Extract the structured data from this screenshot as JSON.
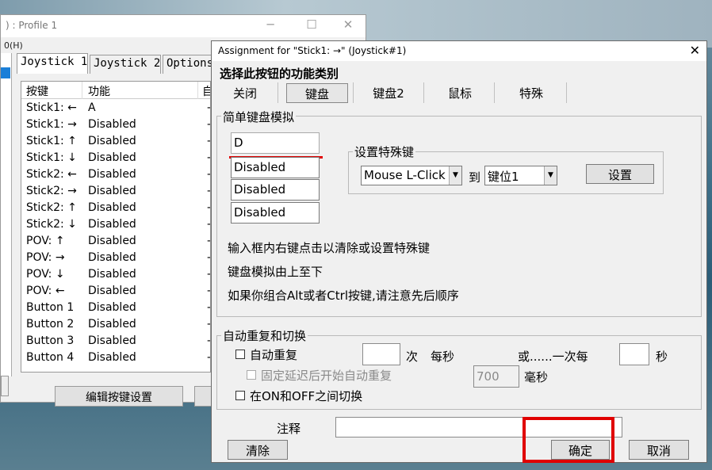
{
  "back_window": {
    "title": ") : Profile 1",
    "menu": "0(H)",
    "controls": {
      "minimize": "─",
      "maximize": "☐",
      "close": "✕"
    },
    "tabs": [
      {
        "label": "Joystick 1"
      },
      {
        "label": "Joystick 2"
      },
      {
        "label": "Options"
      }
    ],
    "list": {
      "headers": [
        "按键",
        "功能",
        "自"
      ],
      "rows": [
        {
          "key": "Stick1: ←",
          "value": "A"
        },
        {
          "key": "Stick1: →",
          "value": "Disabled"
        },
        {
          "key": "Stick1: ↑",
          "value": "Disabled"
        },
        {
          "key": "Stick1: ↓",
          "value": "Disabled"
        },
        {
          "key": "Stick2: ←",
          "value": "Disabled"
        },
        {
          "key": "Stick2: →",
          "value": "Disabled"
        },
        {
          "key": "Stick2: ↑",
          "value": "Disabled"
        },
        {
          "key": "Stick2: ↓",
          "value": "Disabled"
        },
        {
          "key": "POV: ↑",
          "value": "Disabled"
        },
        {
          "key": "POV: →",
          "value": "Disabled"
        },
        {
          "key": "POV: ↓",
          "value": "Disabled"
        },
        {
          "key": "POV: ←",
          "value": "Disabled"
        },
        {
          "key": "Button 1",
          "value": "Disabled"
        },
        {
          "key": "Button 2",
          "value": "Disabled"
        },
        {
          "key": "Button 3",
          "value": "Disabled"
        },
        {
          "key": "Button 4",
          "value": "Disabled"
        }
      ],
      "dash": "-"
    },
    "edit_button": "编辑按键设置"
  },
  "dialog": {
    "title": "Assignment for \"Stick1: →\" (Joystick#1)",
    "close": "✕",
    "heading": "选择此按钮的功能类别",
    "categories": [
      "关闭",
      "键盘",
      "键盘2",
      "鼠标",
      "特殊"
    ],
    "keyboard_group": {
      "label": "简单键盘模拟",
      "fields": [
        "D",
        "Disabled",
        "Disabled",
        "Disabled"
      ],
      "special_key": {
        "label": "设置特殊键",
        "combo1": "Mouse L-Click",
        "to": "到",
        "combo2": "键位1",
        "set_button": "设置"
      },
      "hints": [
        "输入框内右键点击以清除或设置特殊键",
        "键盘模拟由上至下",
        "如果你组合Alt或者Ctrl按键,请注意先后顺序"
      ]
    },
    "repeat_group": {
      "label": "自动重复和切换",
      "auto_repeat": "自动重复",
      "times_value": "",
      "times_unit": "次",
      "per_second": "每秒",
      "or_once_every": "或......一次每",
      "seconds_value": "",
      "seconds_unit": "秒",
      "delay_start": "固定延迟后开始自动重复",
      "delay_value": "700",
      "ms_unit": "毫秒",
      "toggle": "在ON和OFF之间切换"
    },
    "comment_label": "注释",
    "comment_value": "",
    "clear_button": "清除",
    "ok_button": "确定",
    "cancel_button": "取消"
  },
  "colors": {
    "highlight_red": "#e00000",
    "selection_blue": "#1b7fd8"
  }
}
